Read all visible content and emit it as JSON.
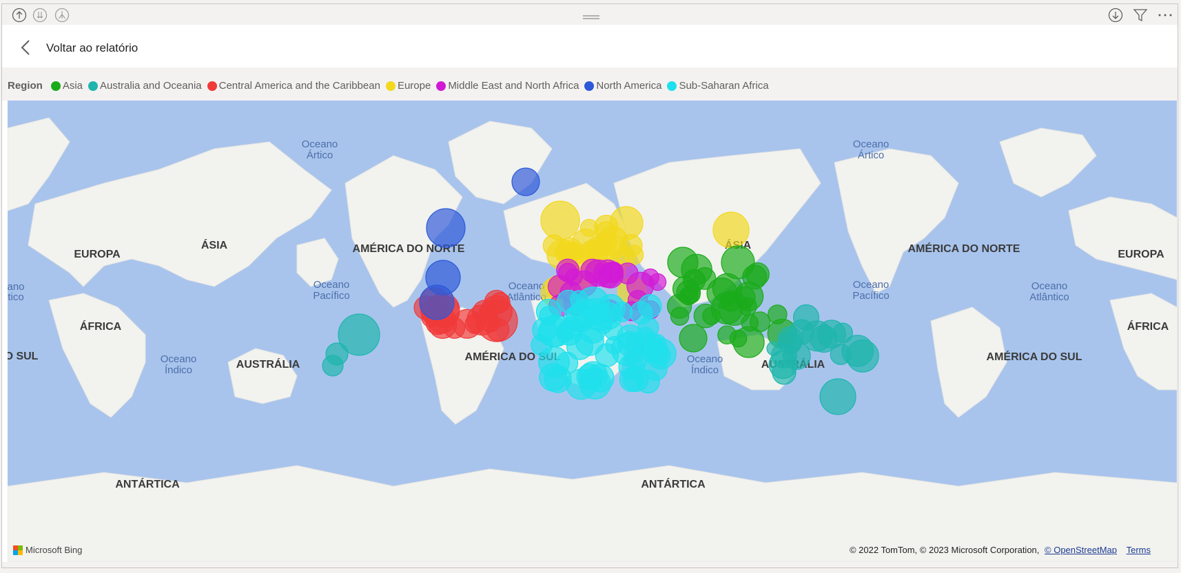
{
  "toolbar": {
    "left_icons": [
      "arrow-up-circle-icon",
      "double-arrow-down-circle-icon",
      "hierarchy-expand-icon"
    ],
    "right_icons": [
      "arrow-down-circle-icon",
      "filter-icon",
      "more-options-icon"
    ]
  },
  "back": {
    "label": "Voltar ao relatório"
  },
  "legend": {
    "title": "Region",
    "items": [
      {
        "label": "Asia",
        "color": "#1aab1a"
      },
      {
        "label": "Australia and Oceania",
        "color": "#1fb5ad"
      },
      {
        "label": "Central America and the Caribbean",
        "color": "#f03a3a"
      },
      {
        "label": "Europe",
        "color": "#f2d81e"
      },
      {
        "label": "Middle East and North Africa",
        "color": "#d21ad6"
      },
      {
        "label": "North America",
        "color": "#2d58d8"
      },
      {
        "label": "Sub-Saharan Africa",
        "color": "#1fe0ec"
      }
    ]
  },
  "map": {
    "labels": [
      "Oceano Ártico",
      "Oceano Ártico",
      "EUROPA",
      "ÁSIA",
      "AMÉRICA DO NORTE",
      "ÁSIA",
      "AMÉRICA DO NORTE",
      "EUROPA",
      "Oceano Pacífico",
      "Oceano Atlântico",
      "Oceano Pacífico",
      "Oceano Atlântico",
      "ÁFRICA",
      "ÁFRICA",
      "O SUL",
      "Oceano Índico",
      "AUSTRÁLIA",
      "AMÉRICA DO SUL",
      "Oceano Índico",
      "AUSTRÁLIA",
      "AMÉRICA DO SUL",
      "ANTÁRTICA",
      "ANTÁRTICA",
      "ano",
      "tico"
    ],
    "bing_label": "Microsoft Bing",
    "attribution": "© 2022 TomTom, © 2023 Microsoft Corporation,",
    "osm_link": "© OpenStreetMap",
    "terms_link": "Terms"
  }
}
